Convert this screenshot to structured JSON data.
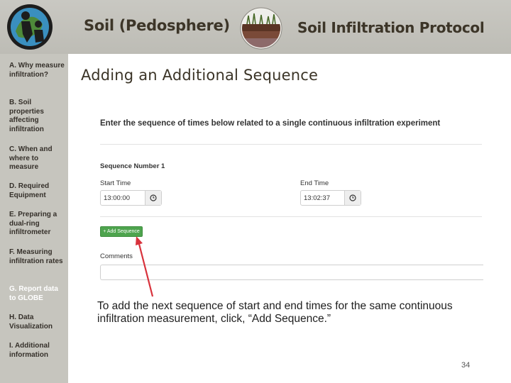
{
  "header": {
    "title_left": "Soil (Pedosphere)",
    "title_right": "Soil Infiltration Protocol",
    "logo_icon": "globe-program-logo-icon",
    "soil_icon": "soil-profile-badge-icon"
  },
  "sidebar": {
    "items": [
      {
        "label": "A. Why measure infiltration?"
      },
      {
        "label": "B. Soil properties affecting infiltration"
      },
      {
        "label": "C. When and where to measure"
      },
      {
        "label": "D. Required Equipment"
      },
      {
        "label": "E. Preparing a dual-ring infiltrometer"
      },
      {
        "label": "F. Measuring infiltration rates"
      },
      {
        "label": "G. Report data to GLOBE",
        "active": true
      },
      {
        "label": "H. Data Visualization"
      },
      {
        "label": "I. Additional information"
      }
    ]
  },
  "slide": {
    "title": "Adding an Additional Sequence",
    "instruction": "To add the next sequence of start and end times for the same continuous infiltration measurement, click, “Add Sequence.”",
    "page_number": "34"
  },
  "form": {
    "prompt": "Enter the sequence of times below related to a single continuous infiltration experiment",
    "sequence_label": "Sequence Number 1",
    "start_time": {
      "label": "Start Time",
      "value": "13:00:00",
      "icon": "clock-icon"
    },
    "end_time": {
      "label": "End Time",
      "value": "13:02:37",
      "icon": "clock-icon"
    },
    "add_sequence_button": "+ Add Sequence",
    "comments_label": "Comments",
    "comments_value": ""
  },
  "colors": {
    "banner": "#c4c3bc",
    "sidebar": "#c6c5be",
    "button_green": "#4ea44e",
    "arrow_red": "#d8323c",
    "active_nav": "#ffffff"
  }
}
